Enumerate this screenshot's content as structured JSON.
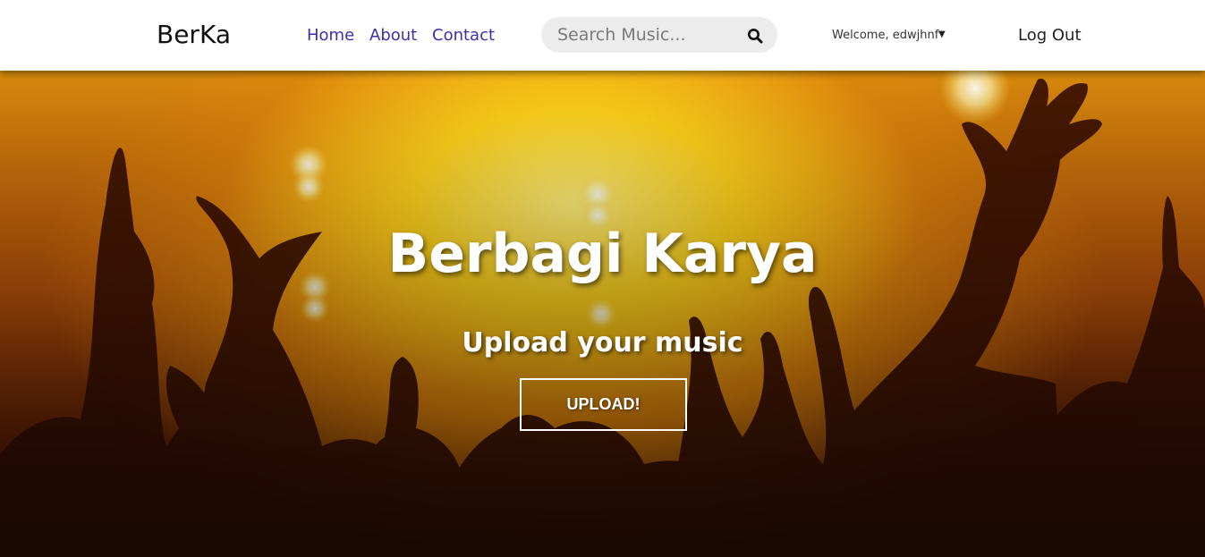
{
  "navbar": {
    "brand": "BerKa",
    "links": [
      "Home",
      "About",
      "Contact"
    ],
    "search_placeholder": "Search Music...",
    "welcome": "Welcome, edwjhnf",
    "logout": "Log Out"
  },
  "hero": {
    "title": "Berbagi Karya",
    "subtitle": "Upload your music",
    "upload_label": "UPLOAD!"
  },
  "colors": {
    "nav_link": "#3a2fb0",
    "hero_glow": "#ffd11a",
    "hero_dark": "#2b0a02"
  },
  "icons": {
    "search": "search-icon",
    "dropdown": "caret-down-icon"
  }
}
